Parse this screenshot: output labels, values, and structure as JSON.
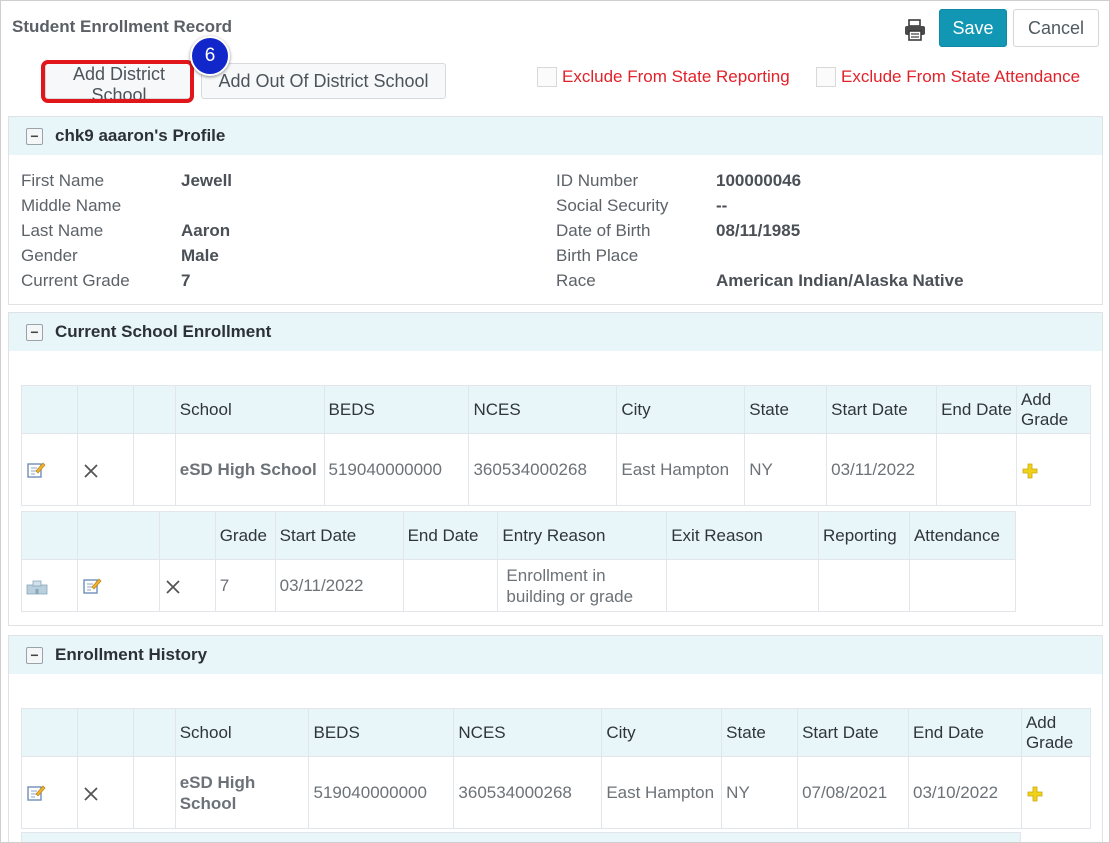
{
  "header": {
    "title": "Student Enrollment Record",
    "save_label": "Save",
    "cancel_label": "Cancel",
    "add_district_label": "Add District School",
    "add_out_label": "Add Out Of District School",
    "step_number": "6",
    "exclude_reporting_label": "Exclude From State Reporting",
    "exclude_attendance_label": "Exclude From State Attendance",
    "print_icon": "printer-icon"
  },
  "profile": {
    "title": "chk9 aaaron's Profile",
    "first_name_label": "First Name",
    "first_name": "Jewell",
    "middle_name_label": "Middle Name",
    "middle_name": "",
    "last_name_label": "Last Name",
    "last_name": "Aaron",
    "gender_label": "Gender",
    "gender": "Male",
    "grade_label": "Current Grade",
    "grade": "7",
    "id_label": "ID Number",
    "id": "100000046",
    "ssn_label": "Social Security",
    "ssn": "--",
    "dob_label": "Date of Birth",
    "dob": "08/11/1985",
    "birthplace_label": "Birth Place",
    "birthplace": "",
    "race_label": "Race",
    "race": "American Indian/Alaska Native"
  },
  "current": {
    "title": "Current School Enrollment",
    "headers": {
      "school": "School",
      "beds": "BEDS",
      "nces": "NCES",
      "city": "City",
      "state": "State",
      "start": "Start Date",
      "end": "End Date",
      "add_grade": "Add Grade"
    },
    "row": {
      "school": "eSD High School",
      "beds": "519040000000",
      "nces": "360534000268",
      "city": "East Hampton",
      "state": "NY",
      "start": "03/11/2022",
      "end": ""
    },
    "grade_headers": {
      "grade": "Grade",
      "start": "Start Date",
      "end": "End Date",
      "entry": "Entry Reason",
      "exit": "Exit Reason",
      "reporting": "Reporting",
      "attendance": "Attendance"
    },
    "grade_row": {
      "grade": "7",
      "start": "03/11/2022",
      "end": "",
      "entry": "Enrollment in building or grade",
      "exit": "",
      "reporting": "",
      "attendance": ""
    }
  },
  "history": {
    "title": "Enrollment History",
    "headers": {
      "school": "School",
      "beds": "BEDS",
      "nces": "NCES",
      "city": "City",
      "state": "State",
      "start": "Start Date",
      "end": "End Date",
      "add_grade": "Add Grade"
    },
    "row": {
      "school": "eSD High School",
      "beds": "519040000000",
      "nces": "360534000268",
      "city": "East Hampton",
      "state": "NY",
      "start": "07/08/2021",
      "end": "03/10/2022"
    }
  }
}
